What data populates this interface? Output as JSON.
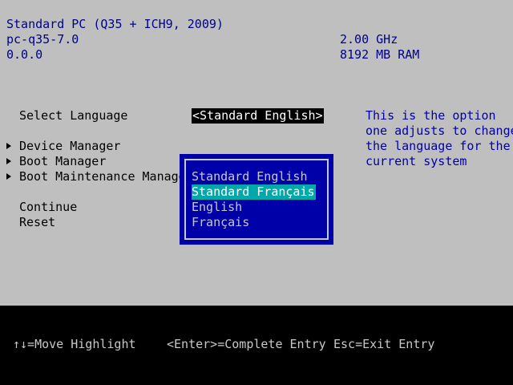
{
  "header": {
    "machine": "Standard PC (Q35 + ICH9, 2009)",
    "version": "pc-q35-7.0",
    "firmware": "0.0.0",
    "cpu": "2.00 GHz",
    "ram": "8192 MB RAM"
  },
  "menu": {
    "select_language": "Select Language",
    "language_value": "<Standard English>",
    "device_manager": "Device Manager",
    "boot_manager": "Boot Manager",
    "boot_maintenance_manager": "Boot Maintenance Manager",
    "continue": "Continue",
    "reset": "Reset"
  },
  "help": {
    "line1": "This is the option",
    "line2": "one adjusts to change",
    "line3": "the language for the",
    "line4": "current system"
  },
  "popup": {
    "options": [
      "Standard English",
      "Standard Français",
      "English",
      "Français"
    ],
    "selected": "Standard Français"
  },
  "footer": {
    "move": "↑↓=Move Highlight",
    "enter": "<Enter>=Complete Entry",
    "esc": "Esc=Exit Entry"
  },
  "colors": {
    "background": "#bfbfbf",
    "header_text": "#00008a",
    "popup_bg": "#0000a8",
    "highlight": "#00a8a8",
    "footer_bg": "#000000"
  }
}
